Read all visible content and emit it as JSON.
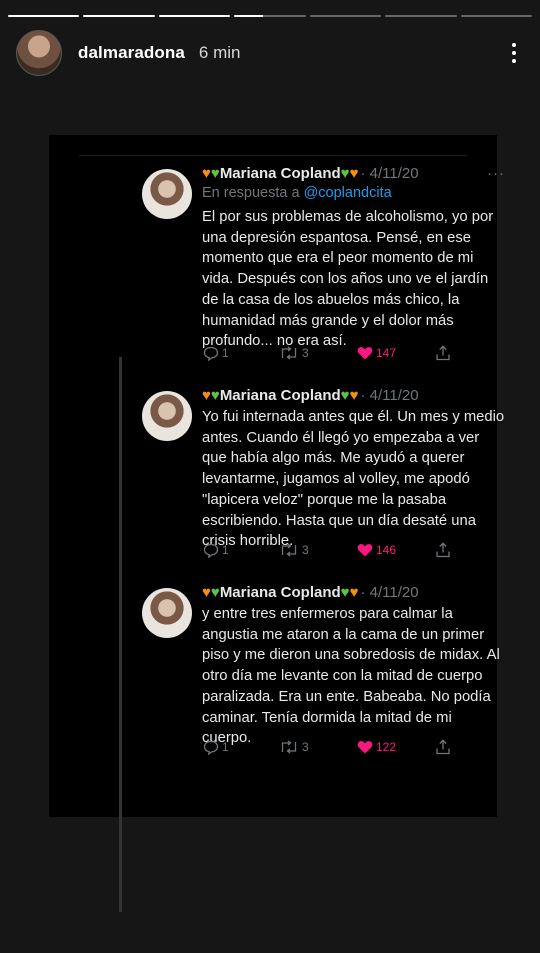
{
  "story": {
    "username": "dalmaradona",
    "time": "6 min",
    "segments": [
      1,
      1,
      1,
      0.4,
      0,
      0,
      0
    ]
  },
  "tweets": [
    {
      "name": "Mariana Copland",
      "date": "· 4/11/20",
      "reply_label": "En respuesta a",
      "reply_handle": "@coplandcita",
      "text": "El por sus problemas de alcoholismo, yo por una depresión espantosa. Pensé, en ese momento que era el peor momento de mi vida. Después con los años uno ve el jardín de la casa de los abuelos más chico, la humanidad más grande y el dolor más profundo... no era así.",
      "replies": "1",
      "retweets": "3",
      "likes": "147"
    },
    {
      "name": "Mariana Copland",
      "date": "· 4/11/20",
      "text": "Yo fui internada antes que él. Un mes y medio antes. Cuando él llegó yo empezaba a ver que había algo más. Me ayudó a querer levantarme, jugamos al volley, me apodó \"lapicera veloz\" porque me la pasaba escribiendo. Hasta que un día desaté una crisis horrible.",
      "replies": "1",
      "retweets": "3",
      "likes": "146"
    },
    {
      "name": "Mariana Copland",
      "date": "· 4/11/20",
      "text": "y entre tres enfermeros para calmar la angustia me ataron a la cama de un primer piso y me dieron una sobredosis de midax. Al otro día me levante con la mitad de cuerpo paralizada. Era un ente. Babeaba. No podía caminar. Tenía dormida la mitad de mi cuerpo.",
      "replies": "1",
      "retweets": "3",
      "likes": "122"
    }
  ],
  "colors": {
    "background": "#161616",
    "card": "#000000",
    "muted": "#71767b",
    "link": "#1d9bf0",
    "like": "#f91880",
    "heart_orange": "#f4900c",
    "heart_green": "#5cc443"
  }
}
